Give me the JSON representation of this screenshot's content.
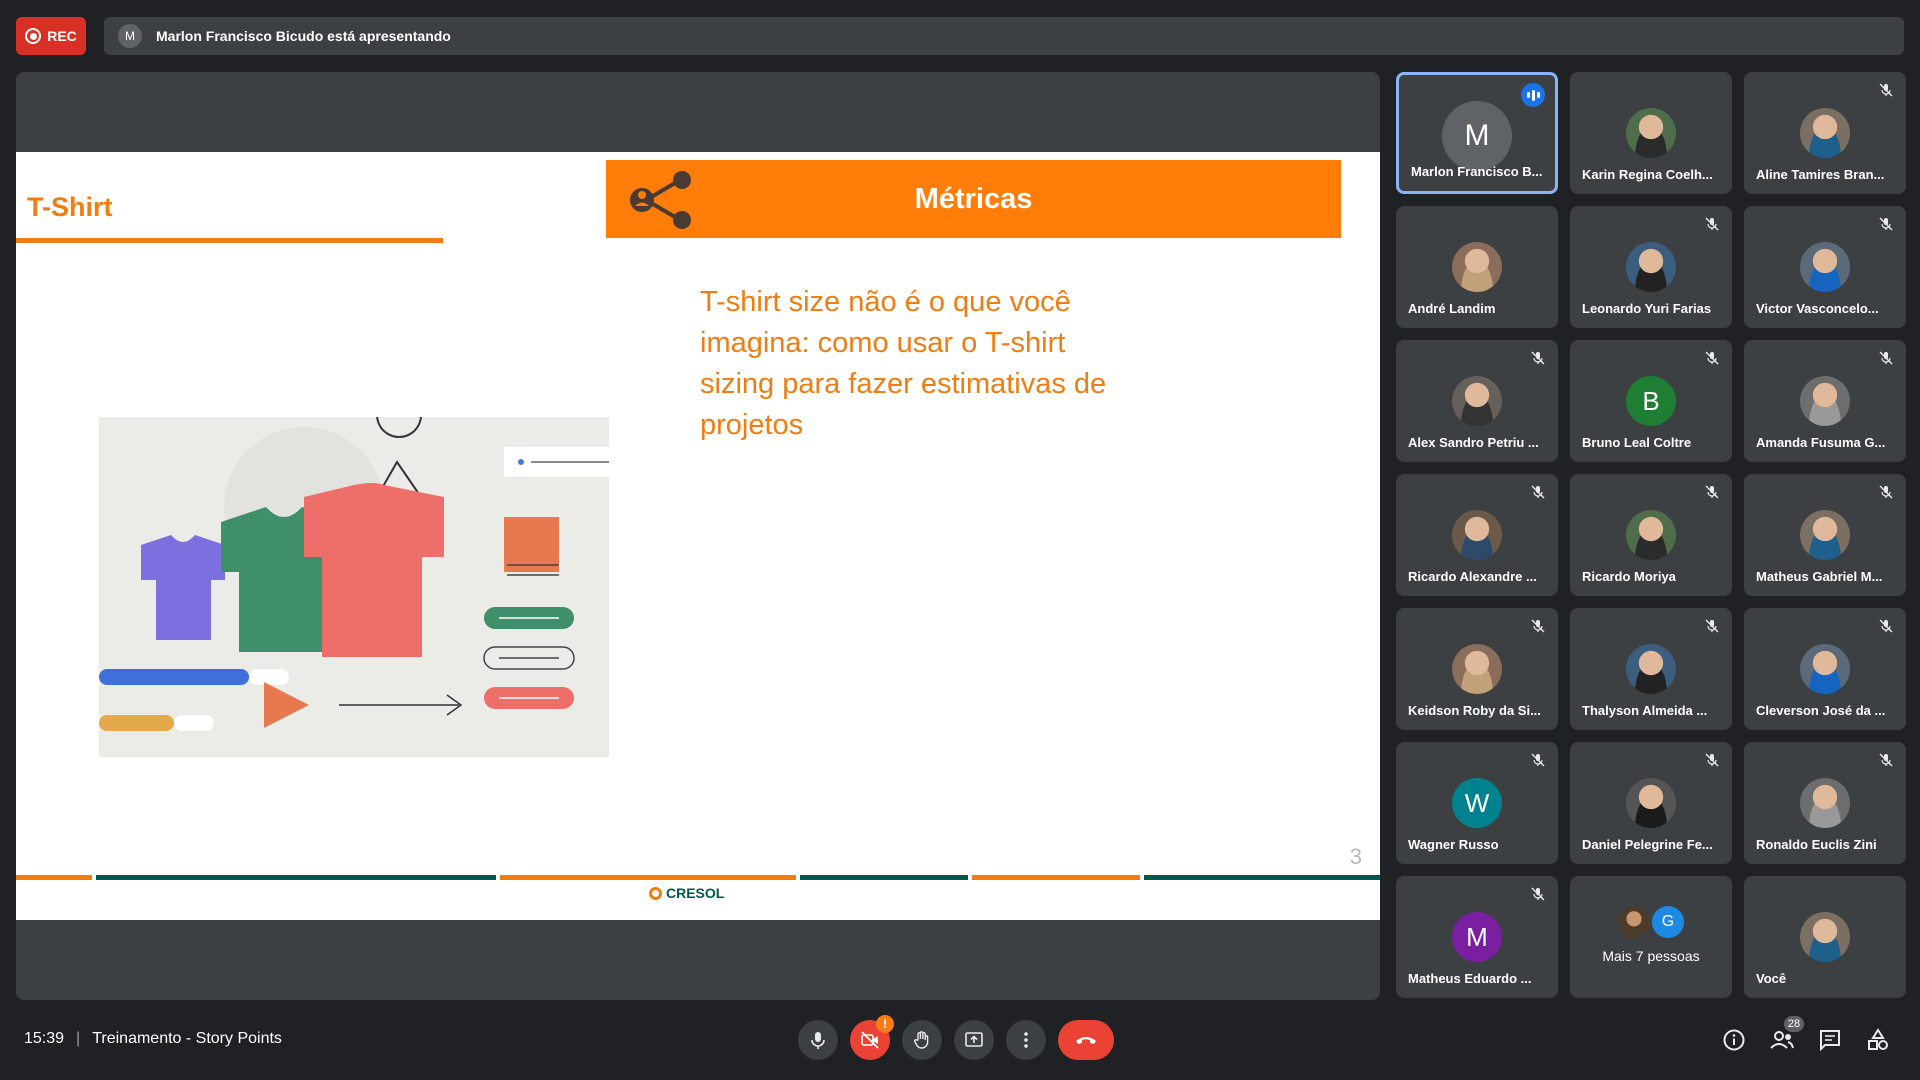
{
  "top_bar": {
    "rec_label": "REC",
    "presenter_initial": "M",
    "presenting_text": "Marlon Francisco Bicudo está apresentando"
  },
  "slide": {
    "title": "T-Shirt",
    "banner_label": "Métricas",
    "body_text": "T-shirt size não é o que você imagina: como usar o T-shirt sizing para fazer estimativas de projetos",
    "page_number": "3",
    "brand": "CRESOL",
    "colors": {
      "orange": "#f07d12",
      "banner": "#ff7d08",
      "green": "#00594f"
    }
  },
  "participants": [
    {
      "name": "Marlon Francisco B...",
      "initial": "M",
      "avatar_color": "#5f6368",
      "status": "speaking"
    },
    {
      "name": "Karin Regina Coelh...",
      "photo": true,
      "status": ""
    },
    {
      "name": "Aline Tamires Bran...",
      "photo": true,
      "status": "muted"
    },
    {
      "name": "André Landim",
      "photo": true,
      "status": ""
    },
    {
      "name": "Leonardo Yuri Farias",
      "photo": true,
      "status": "muted"
    },
    {
      "name": "Victor Vasconcelo...",
      "photo": true,
      "status": "muted"
    },
    {
      "name": "Alex Sandro Petriu ...",
      "photo": true,
      "status": "muted"
    },
    {
      "name": "Bruno Leal Coltre",
      "initial": "B",
      "avatar_color": "#1e7e34",
      "status": "muted"
    },
    {
      "name": "Amanda Fusuma G...",
      "photo": true,
      "status": "muted"
    },
    {
      "name": "Ricardo Alexandre ...",
      "photo": true,
      "status": "muted"
    },
    {
      "name": "Ricardo Moriya",
      "photo": true,
      "status": "muted"
    },
    {
      "name": "Matheus Gabriel M...",
      "photo": true,
      "status": "muted"
    },
    {
      "name": "Keidson Roby da Si...",
      "photo": true,
      "status": "muted"
    },
    {
      "name": "Thalyson Almeida ...",
      "photo": true,
      "status": "muted"
    },
    {
      "name": "Cleverson José da ...",
      "photo": true,
      "status": "muted"
    },
    {
      "name": "Wagner Russo",
      "initial": "W",
      "avatar_color": "#00838f",
      "status": "muted"
    },
    {
      "name": "Daniel Pelegrine Fe...",
      "photo": true,
      "status": "muted"
    },
    {
      "name": "Ronaldo Euclis Zini",
      "photo": true,
      "status": "muted"
    },
    {
      "name": "Matheus Eduardo ...",
      "initial": "M",
      "avatar_color": "#7b1fa2",
      "status": "muted"
    },
    {
      "name": "Mais 7 pessoas",
      "more": true,
      "second_initial": "G"
    },
    {
      "name": "Você",
      "photo": true,
      "status": ""
    }
  ],
  "bottom_bar": {
    "time": "15:39",
    "meeting_title": "Treinamento - Story Points",
    "camera_warning": "!",
    "participants_count": "28"
  }
}
